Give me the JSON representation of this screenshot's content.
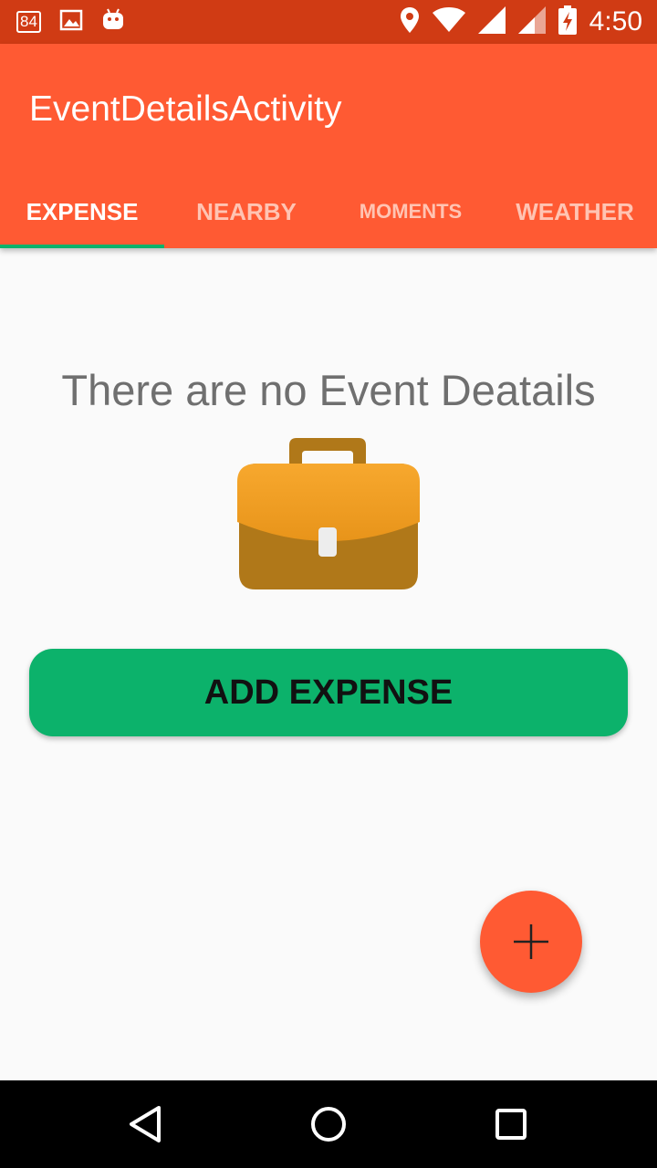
{
  "status_bar": {
    "battery_badge": "84",
    "time": "4:50",
    "icons": [
      "battery-notification-icon",
      "image-icon",
      "android-icon",
      "location-icon",
      "wifi-icon",
      "signal-icon",
      "signal-icon",
      "battery-charging-icon"
    ]
  },
  "app_bar": {
    "title": "EventDetailsActivity",
    "background": "#ff5a33",
    "tabs": [
      {
        "label": "EXPENSE",
        "active": true
      },
      {
        "label": "NEARBY",
        "active": false
      },
      {
        "label": "MOMENTS",
        "active": false
      },
      {
        "label": "WEATHER",
        "active": false
      }
    ],
    "indicator_color": "#0cb26b"
  },
  "main": {
    "empty_message": "There are no Event Deatails",
    "illustration": "briefcase-icon",
    "add_button_label": "ADD EXPENSE",
    "add_button_color": "#0cb26b"
  },
  "fab": {
    "icon": "plus-icon",
    "color": "#ff5a33"
  },
  "nav_bar": {
    "buttons": [
      "back-icon",
      "home-icon",
      "recents-icon"
    ]
  }
}
